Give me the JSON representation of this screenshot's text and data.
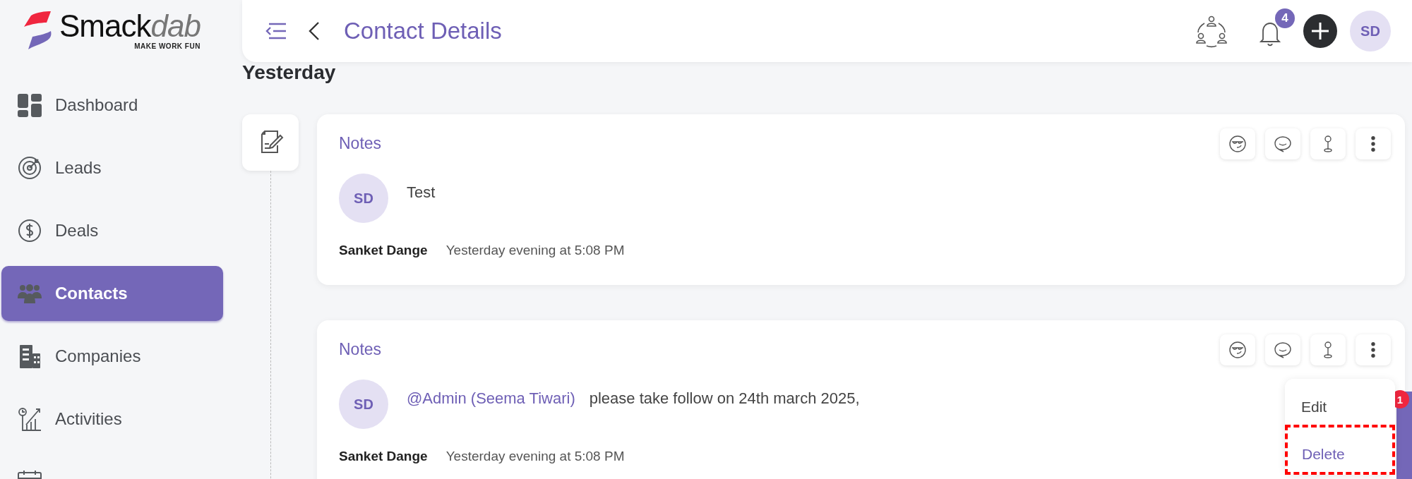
{
  "brand": {
    "name": "Smack",
    "name_suffix": "dab",
    "tagline": "MAKE WORK FUN"
  },
  "sidebar": {
    "items": [
      {
        "label": "Dashboard",
        "kind": "dashboard",
        "selected": false
      },
      {
        "label": "Leads",
        "kind": "leads",
        "selected": false
      },
      {
        "label": "Deals",
        "kind": "deals",
        "selected": false
      },
      {
        "label": "Contacts",
        "kind": "contacts",
        "selected": true
      },
      {
        "label": "Companies",
        "kind": "companies",
        "selected": false
      },
      {
        "label": "Activities",
        "kind": "activities",
        "selected": false
      },
      {
        "kind": "calendar",
        "selected": false
      }
    ]
  },
  "header": {
    "title": "Contact Details",
    "notification_count": "4",
    "avatar": "SD"
  },
  "timeline": {
    "group": "Yesterday",
    "notes": [
      {
        "title": "Notes",
        "avatar": "SD",
        "text": "Test",
        "author": "Sanket Dange",
        "time": "Yesterday evening at 5:08 PM"
      },
      {
        "title": "Notes",
        "avatar": "SD",
        "mention": "@Admin (Seema Tiwari)",
        "text": "please take follow on 24th march 2025,",
        "author": "Sanket Dange",
        "time": "Yesterday evening at 5:08 PM"
      }
    ]
  },
  "menu": {
    "items": [
      {
        "label": "Edit",
        "selected": false,
        "highlighted": false
      },
      {
        "label": "Delete",
        "selected": true,
        "highlighted": true
      }
    ]
  },
  "side_tab": {
    "badge": "1"
  }
}
